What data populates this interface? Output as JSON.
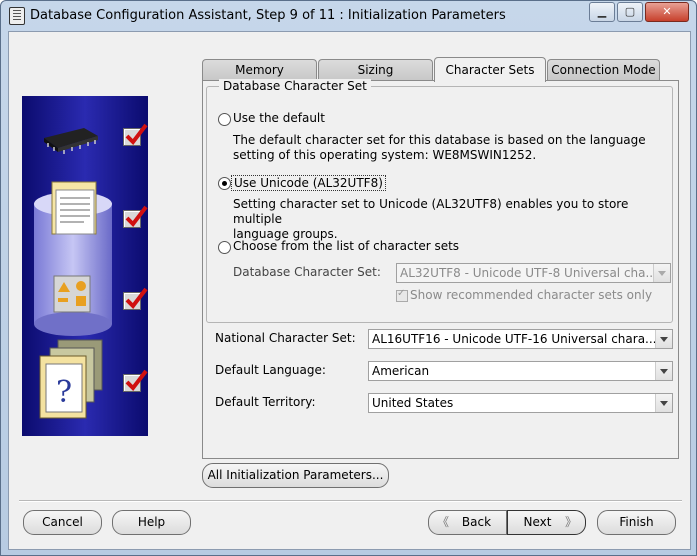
{
  "window": {
    "title": "Database Configuration Assistant, Step 9 of 11 : Initialization Parameters",
    "controls": {
      "minimize": "▁",
      "maximize": "▢",
      "close": "✕"
    }
  },
  "tabs": [
    {
      "label": "Memory",
      "active": false
    },
    {
      "label": "Sizing",
      "active": false
    },
    {
      "label": "Character Sets",
      "active": true
    },
    {
      "label": "Connection Mode",
      "active": false
    }
  ],
  "db_charset": {
    "legend": "Database Character Set",
    "option_default": {
      "label": "Use the default",
      "selected": false,
      "desc_line1": "The default character set for this database is based on the language",
      "desc_line2": "setting of this operating system: WE8MSWIN1252."
    },
    "option_unicode": {
      "label": "Use Unicode (AL32UTF8)",
      "selected": true,
      "desc_line1": "Setting character set to Unicode (AL32UTF8) enables you to store multiple",
      "desc_line2": "language groups."
    },
    "option_choose": {
      "label": "Choose from the list of character sets",
      "selected": false,
      "field_label": "Database Character Set:",
      "field_value": "AL32UTF8 - Unicode UTF-8 Universal cha...",
      "show_recommended": "Show recommended character sets only"
    }
  },
  "national": {
    "label": "National Character Set:",
    "value": "AL16UTF16 - Unicode UTF-16 Universal chara..."
  },
  "language": {
    "label": "Default Language:",
    "value": "American"
  },
  "territory": {
    "label": "Default Territory:",
    "value": "United States"
  },
  "all_params_button": "All Initialization Parameters...",
  "footer": {
    "cancel": "Cancel",
    "help": "Help",
    "back": "Back",
    "next": "Next",
    "finish": "Finish"
  },
  "colors": {
    "side_panel": "#1a1a9c",
    "check_mark": "#d01010"
  }
}
